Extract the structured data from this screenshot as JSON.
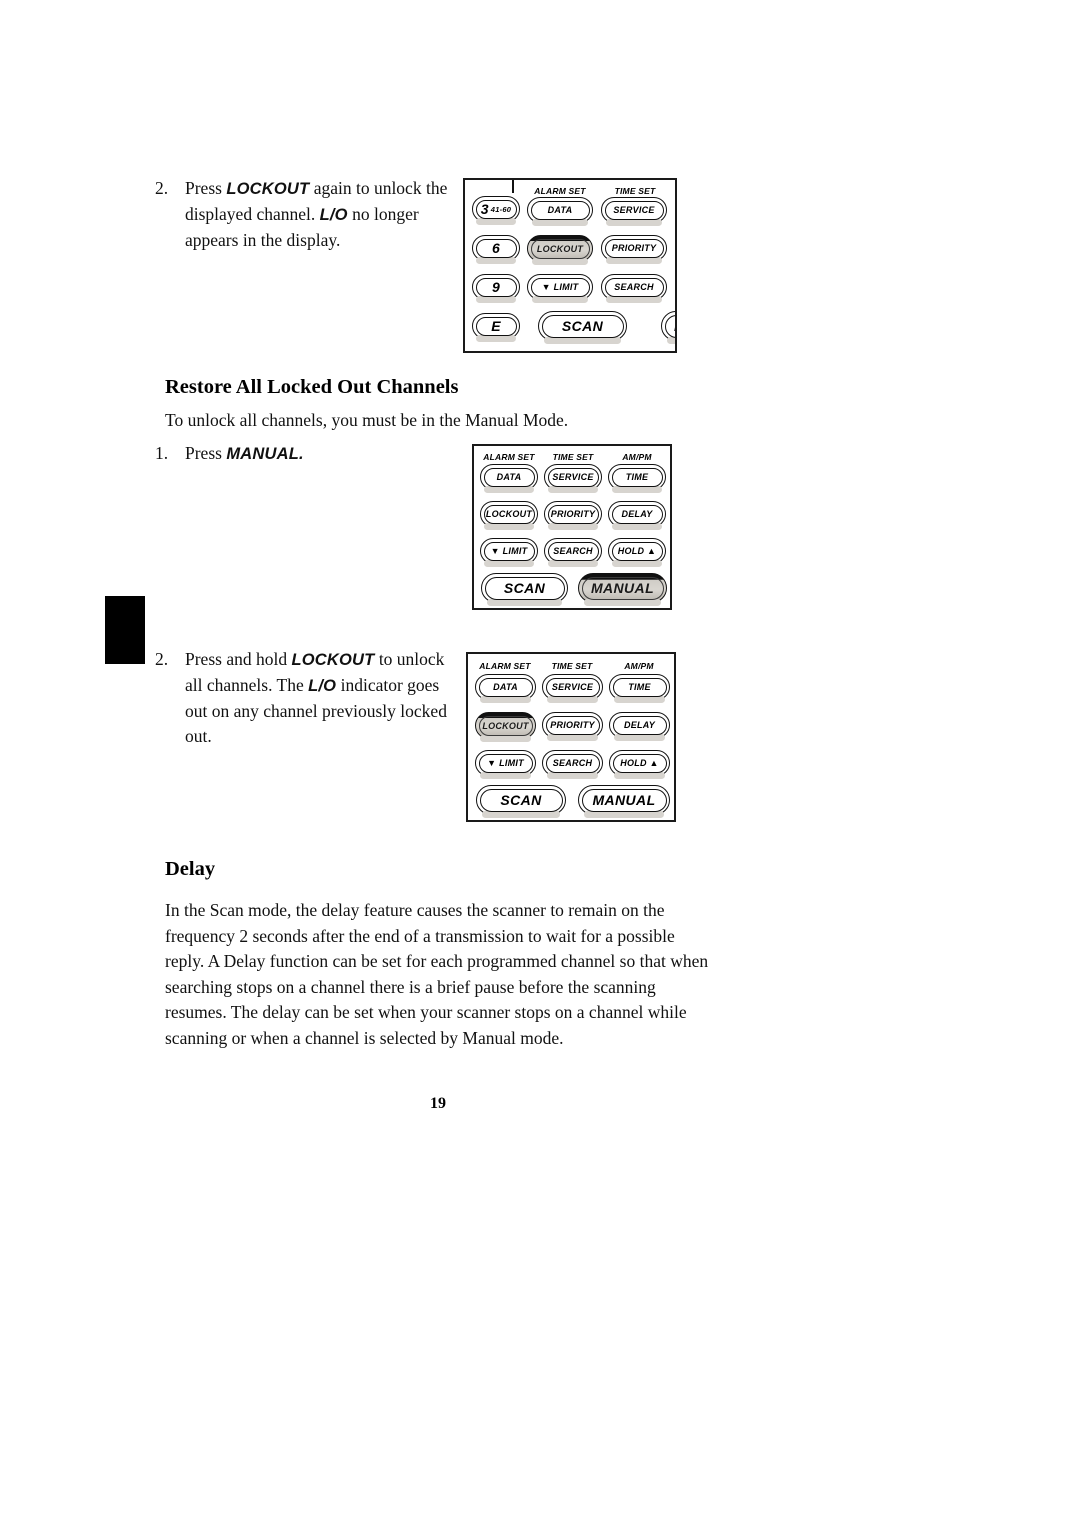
{
  "page": {
    "number": "19"
  },
  "steps": {
    "lockout_again": {
      "num": "2.",
      "text_a": "Press ",
      "kb1": "LOCKOUT",
      "text_b": " again to unlock the displayed channel. ",
      "kb2": "L/O",
      "text_c": " no longer appears in the display."
    },
    "press_manual": {
      "num": "1.",
      "text_a": "Press ",
      "kb1": "MANUAL.",
      "text_b": ""
    },
    "hold_lockout": {
      "num": "2.",
      "text_a": "Press and hold ",
      "kb1": "LOCKOUT",
      "text_b": " to unlock all channels. The ",
      "kb2": "L/O",
      "text_c": " indicator goes out on any channel previously locked out."
    }
  },
  "sections": {
    "restore": {
      "heading": "Restore All Locked Out Channels",
      "intro": "To unlock all channels, you must be in the Manual Mode."
    },
    "delay": {
      "heading": "Delay",
      "body": "In the Scan mode, the delay feature causes the scanner to remain on the frequency 2 seconds after the end of a transmission to wait for a possible reply. A Delay function can be set for each programmed channel so that when searching stops on a channel there is a brief pause before the scanning resumes. The delay can be set when your scanner stops on a channel while scanning or when a channel is selected by Manual mode."
    }
  },
  "keypads": {
    "keypad_lockout_cropped": {
      "col_labels": [
        "ALARM SET",
        "TIME SET"
      ],
      "channel_keys": [
        {
          "label": "3",
          "sub": "41-60"
        },
        {
          "label": "6",
          "sub": ""
        },
        {
          "label": "9",
          "sub": ""
        },
        {
          "label": "E",
          "sub": ""
        }
      ],
      "keys": [
        {
          "label": "DATA",
          "highlighted": false
        },
        {
          "label": "SERVICE",
          "highlighted": false
        },
        {
          "label": "LOCKOUT",
          "highlighted": true
        },
        {
          "label": "PRIORITY",
          "highlighted": false
        },
        {
          "label": "▼ LIMIT",
          "highlighted": false
        },
        {
          "label": "SEARCH",
          "highlighted": false
        },
        {
          "label": "SCAN",
          "highlighted": false
        }
      ]
    },
    "keypad_manual": {
      "col_labels": [
        "ALARM SET",
        "TIME SET",
        "AM/PM"
      ],
      "rows": [
        [
          {
            "label": "DATA"
          },
          {
            "label": "SERVICE"
          },
          {
            "label": "TIME"
          }
        ],
        [
          {
            "label": "LOCKOUT"
          },
          {
            "label": "PRIORITY"
          },
          {
            "label": "DELAY"
          }
        ],
        [
          {
            "label": "▼ LIMIT"
          },
          {
            "label": "SEARCH"
          },
          {
            "label": "HOLD ▲"
          }
        ]
      ],
      "bottom": [
        {
          "label": "SCAN",
          "highlighted": false
        },
        {
          "label": "MANUAL",
          "highlighted": true
        }
      ]
    },
    "keypad_lockout_full": {
      "col_labels": [
        "ALARM SET",
        "TIME SET",
        "AM/PM"
      ],
      "rows": [
        [
          {
            "label": "DATA",
            "highlighted": false
          },
          {
            "label": "SERVICE",
            "highlighted": false
          },
          {
            "label": "TIME",
            "highlighted": false
          }
        ],
        [
          {
            "label": "LOCKOUT",
            "highlighted": true
          },
          {
            "label": "PRIORITY",
            "highlighted": false
          },
          {
            "label": "DELAY",
            "highlighted": false
          }
        ],
        [
          {
            "label": "▼ LIMIT",
            "highlighted": false
          },
          {
            "label": "SEARCH",
            "highlighted": false
          },
          {
            "label": "HOLD ▲",
            "highlighted": false
          }
        ]
      ],
      "bottom": [
        {
          "label": "SCAN",
          "highlighted": false
        },
        {
          "label": "MANUAL",
          "highlighted": false
        }
      ]
    }
  }
}
